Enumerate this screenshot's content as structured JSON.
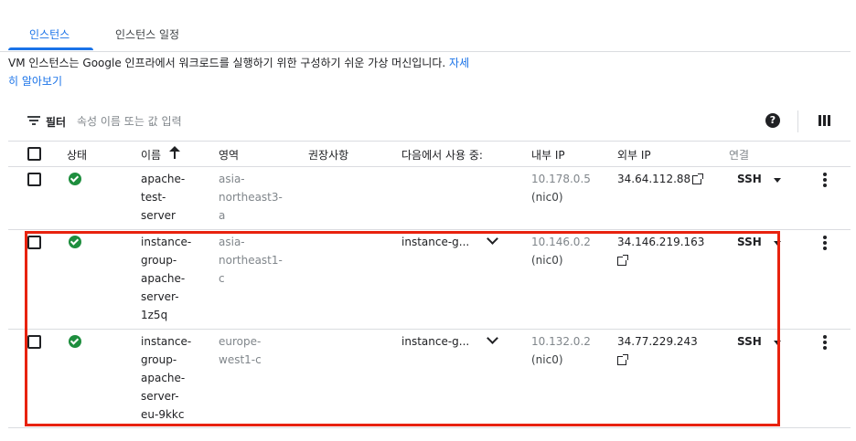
{
  "tabs": [
    {
      "label": "인스턴스",
      "active": true
    },
    {
      "label": "인스턴스 일정",
      "active": false
    }
  ],
  "description": {
    "text": "VM 인스턴스는 Google 인프라에서 워크로드를 실행하기 위한 구성하기 쉬운 가상 머신입니다.",
    "link_part1": "자세",
    "link_part2": "히 알아보기"
  },
  "filter": {
    "label": "필터",
    "placeholder": "속성 이름 또는 값 입력"
  },
  "icons": {
    "filter": "filter-icon",
    "help": "help-icon",
    "columns": "column-display-icon",
    "sort": "arrow-upward-icon",
    "status_ok": "check-circle-icon",
    "external": "open-in-new-icon",
    "expand": "chevron-down-icon",
    "more": "more-vert-icon"
  },
  "help_glyph": "?",
  "table": {
    "headers": {
      "status": "상태",
      "name": "이름",
      "zone": "영역",
      "recommendation": "권장사항",
      "in_use_by": "다음에서 사용 중:",
      "internal_ip": "내부 IP",
      "external_ip": "외부 IP",
      "connect": "연결"
    },
    "rows": [
      {
        "name": "apache-test-server",
        "name_lines": [
          "apache-",
          "test-",
          "server"
        ],
        "zone_lines": [
          "asia-",
          "northeast3-",
          "a"
        ],
        "in_use_by": "",
        "internal_ip": "10.178.0.5",
        "internal_nic": "(nic0)",
        "external_ip": "34.64.112.88",
        "connect": "SSH"
      },
      {
        "name": "instance-group-apache-server-1z5q",
        "name_lines": [
          "instance-",
          "group-",
          "apache-",
          "server-",
          "1z5q"
        ],
        "zone_lines": [
          "asia-",
          "northeast1-",
          "c"
        ],
        "in_use_by": "instance-g...",
        "internal_ip": "10.146.0.2",
        "internal_nic": "(nic0)",
        "external_ip": "34.146.219.163",
        "connect": "SSH"
      },
      {
        "name": "instance-group-apache-server-eu-9kkc",
        "name_lines": [
          "instance-",
          "group-",
          "apache-",
          "server-",
          "eu-9kkc"
        ],
        "zone_lines": [
          "europe-",
          "west1-c"
        ],
        "in_use_by": "instance-g...",
        "internal_ip": "10.132.0.2",
        "internal_nic": "(nic0)",
        "external_ip": "34.77.229.243",
        "connect": "SSH"
      }
    ]
  },
  "colors": {
    "accent": "#1a73e8",
    "status_ok": "#1e8e3e",
    "highlight": "#e8220e"
  }
}
